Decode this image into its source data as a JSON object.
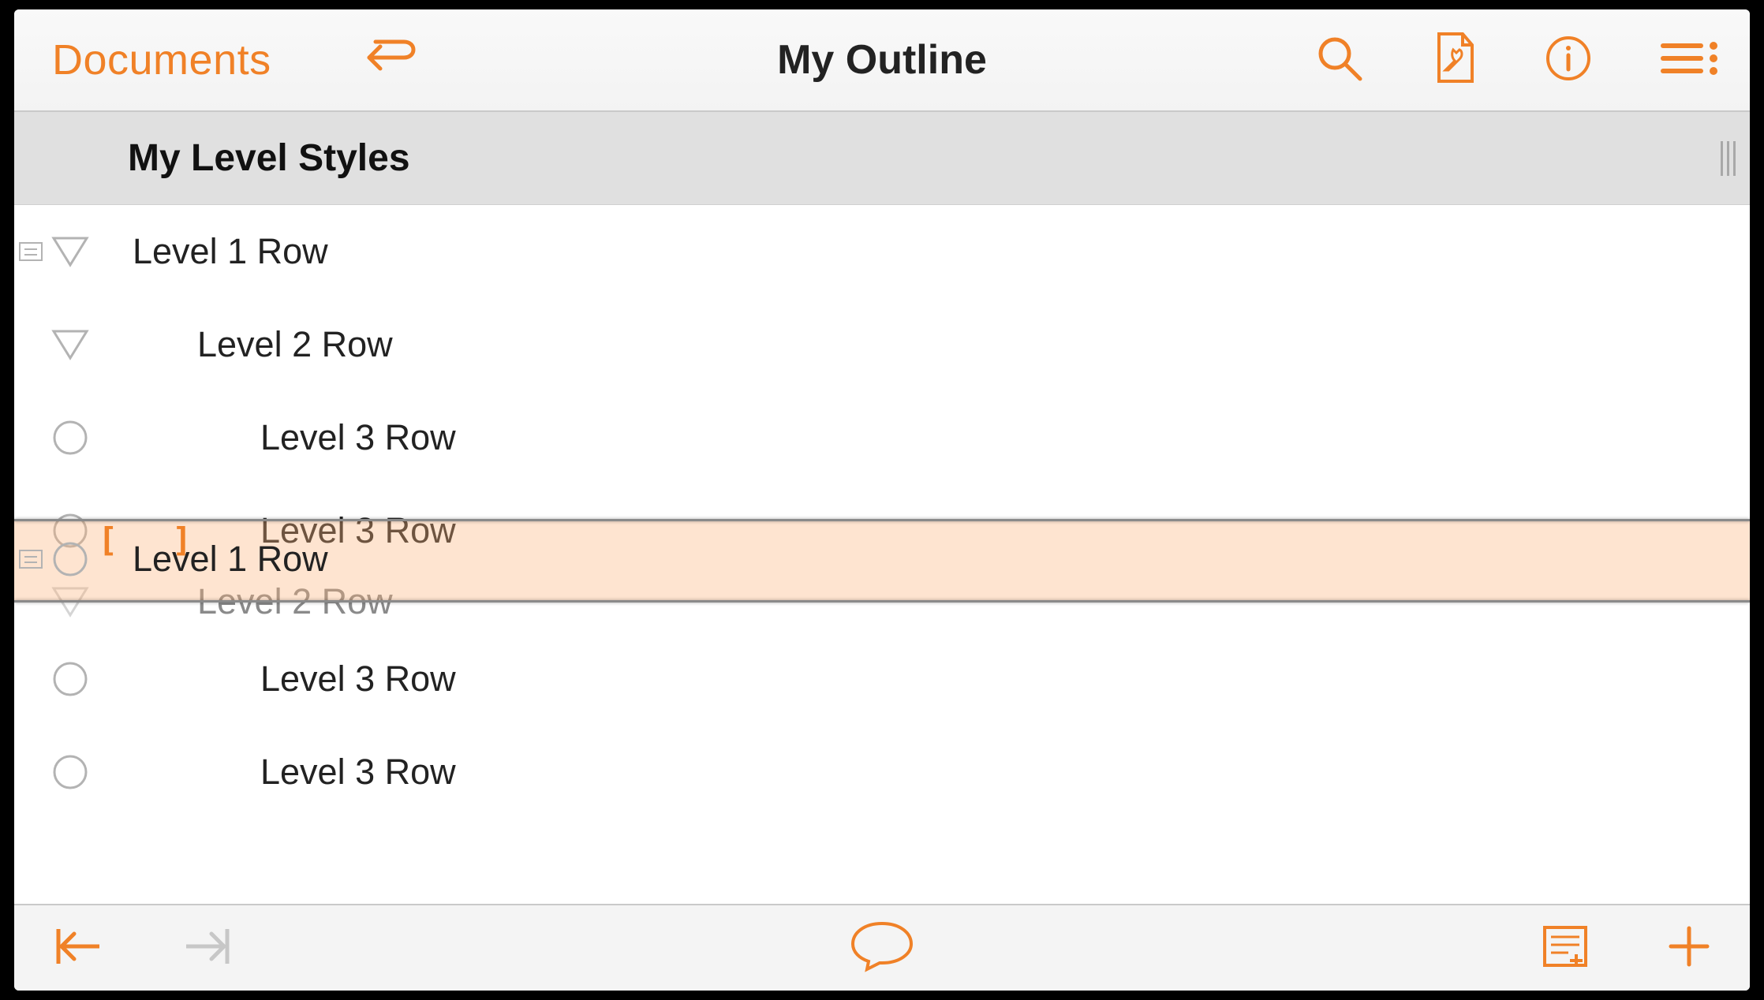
{
  "colors": {
    "accent": "#f08127"
  },
  "toolbar": {
    "documents_label": "Documents",
    "title": "My Outline"
  },
  "section": {
    "title": "My Level Styles"
  },
  "rows": {
    "r0_text": "Level 1 Row",
    "r1_text": "Level 2 Row",
    "r2_text": "Level 3 Row",
    "r3_text": "Level 3 Row",
    "r4_ghost_text": "Level 2 Row",
    "r5_text": "Level 3 Row",
    "r6_text": "Level 3 Row"
  },
  "drag": {
    "row_text": "Level 1 Row"
  }
}
